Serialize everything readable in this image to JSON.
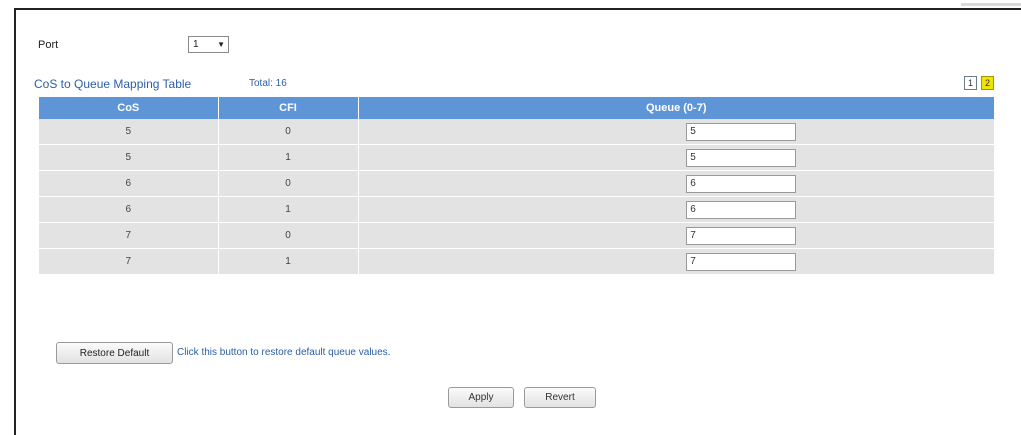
{
  "port": {
    "label": "Port",
    "selected": "1"
  },
  "table": {
    "title": "CoS to Queue Mapping Table",
    "total": "Total: 16",
    "pages": [
      "1",
      "2"
    ],
    "active_page": "2",
    "columns": [
      "CoS",
      "CFI",
      "Queue (0-7)"
    ],
    "rows": [
      {
        "cos": "5",
        "cfi": "0",
        "queue": "5"
      },
      {
        "cos": "5",
        "cfi": "1",
        "queue": "5"
      },
      {
        "cos": "6",
        "cfi": "0",
        "queue": "6"
      },
      {
        "cos": "6",
        "cfi": "1",
        "queue": "6"
      },
      {
        "cos": "7",
        "cfi": "0",
        "queue": "7"
      },
      {
        "cos": "7",
        "cfi": "1",
        "queue": "7"
      }
    ]
  },
  "restore": {
    "button_label": "Restore Default",
    "hint": "Click this button to restore default queue values."
  },
  "actions": {
    "apply_label": "Apply",
    "revert_label": "Revert"
  },
  "colors": {
    "header_bg": "#5e95d6",
    "link_text": "#2b5fa6",
    "active_page": "#f0e400"
  }
}
